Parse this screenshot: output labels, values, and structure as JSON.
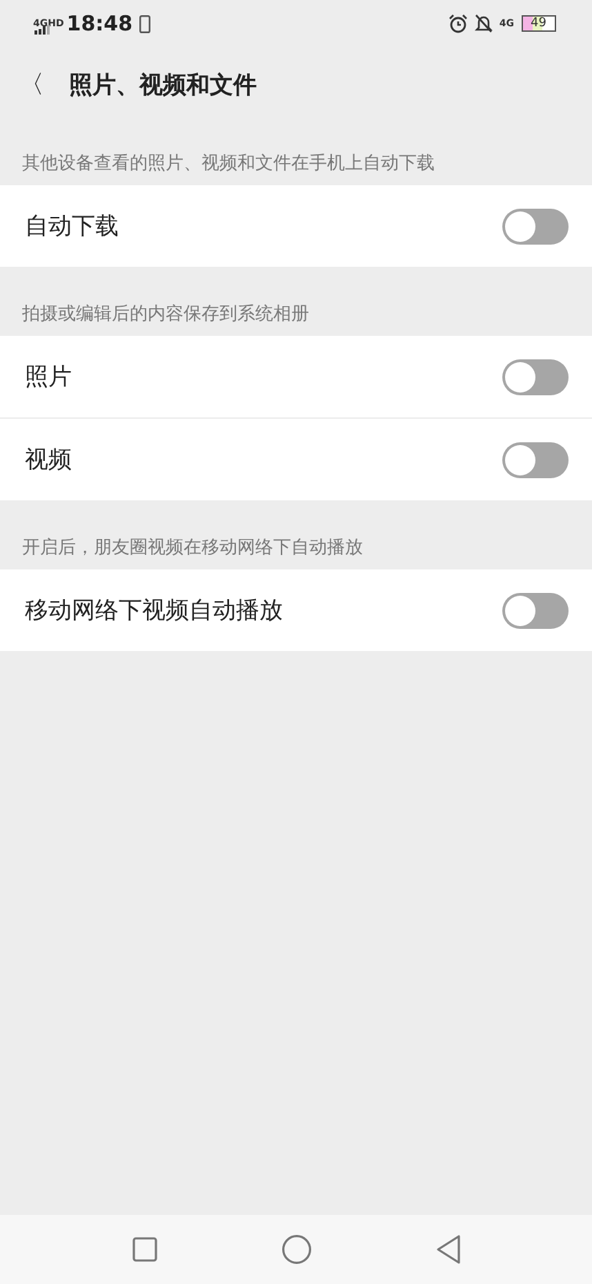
{
  "status_bar": {
    "left_network": "4GHD",
    "time": "18:48",
    "right_network": "4G",
    "battery": "49"
  },
  "header": {
    "back_icon": "〈",
    "title": "照片、视频和文件"
  },
  "sections": [
    {
      "caption": "其他设备查看的照片、视频和文件在手机上自动下载",
      "rows": [
        {
          "label": "自动下载",
          "on": false
        }
      ]
    },
    {
      "caption": "拍摄或编辑后的内容保存到系统相册",
      "rows": [
        {
          "label": "照片",
          "on": false
        },
        {
          "label": "视频",
          "on": false
        }
      ]
    },
    {
      "caption": "开启后，朋友圈视频在移动网络下自动播放",
      "rows": [
        {
          "label": "移动网络下视频自动播放",
          "on": false
        }
      ]
    }
  ]
}
